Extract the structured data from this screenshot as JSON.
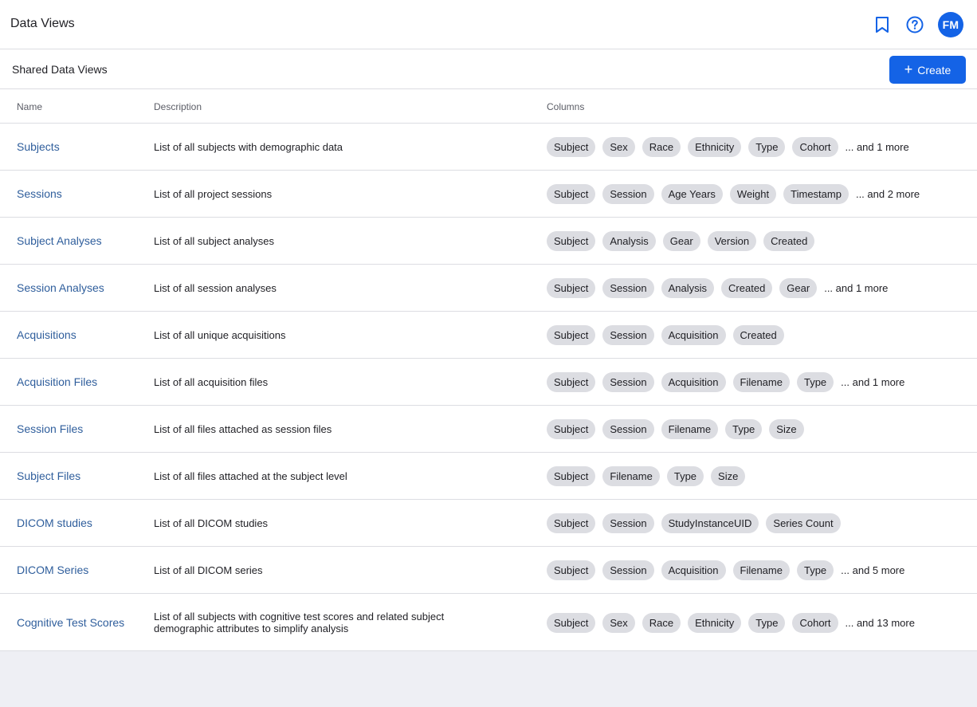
{
  "header": {
    "title": "Data Views",
    "avatar_initials": "FM"
  },
  "panel": {
    "subtitle": "Shared Data Views",
    "create_label": "Create"
  },
  "table": {
    "headers": {
      "name": "Name",
      "description": "Description",
      "columns": "Columns"
    },
    "rows": [
      {
        "name": "Subjects",
        "description": "List of all subjects with demographic data",
        "columns": [
          "Subject",
          "Sex",
          "Race",
          "Ethnicity",
          "Type",
          "Cohort"
        ],
        "more": "... and 1 more"
      },
      {
        "name": "Sessions",
        "description": "List of all project sessions",
        "columns": [
          "Subject",
          "Session",
          "Age Years",
          "Weight",
          "Timestamp"
        ],
        "more": "... and 2 more"
      },
      {
        "name": "Subject Analyses",
        "description": "List of all subject analyses",
        "columns": [
          "Subject",
          "Analysis",
          "Gear",
          "Version",
          "Created"
        ],
        "more": ""
      },
      {
        "name": "Session Analyses",
        "description": "List of all session analyses",
        "columns": [
          "Subject",
          "Session",
          "Analysis",
          "Created",
          "Gear"
        ],
        "more": "... and 1 more"
      },
      {
        "name": "Acquisitions",
        "description": "List of all unique acquisitions",
        "columns": [
          "Subject",
          "Session",
          "Acquisition",
          "Created"
        ],
        "more": ""
      },
      {
        "name": "Acquisition Files",
        "description": "List of all acquisition files",
        "columns": [
          "Subject",
          "Session",
          "Acquisition",
          "Filename",
          "Type"
        ],
        "more": "... and 1 more"
      },
      {
        "name": "Session Files",
        "description": "List of all files attached as session files",
        "columns": [
          "Subject",
          "Session",
          "Filename",
          "Type",
          "Size"
        ],
        "more": ""
      },
      {
        "name": "Subject Files",
        "description": "List of all files attached at the subject level",
        "columns": [
          "Subject",
          "Filename",
          "Type",
          "Size"
        ],
        "more": ""
      },
      {
        "name": "DICOM studies",
        "description": "List of all DICOM studies",
        "columns": [
          "Subject",
          "Session",
          "StudyInstanceUID",
          "Series Count"
        ],
        "more": ""
      },
      {
        "name": "DICOM Series",
        "description": "List of all DICOM series",
        "columns": [
          "Subject",
          "Session",
          "Acquisition",
          "Filename",
          "Type"
        ],
        "more": "... and 5 more"
      },
      {
        "name": "Cognitive Test Scores",
        "description": "List of all subjects with cognitive test scores and related subject demographic attributes to simplify analysis",
        "columns": [
          "Subject",
          "Sex",
          "Race",
          "Ethnicity",
          "Type",
          "Cohort"
        ],
        "more": "... and 13 more"
      }
    ]
  },
  "icons": {
    "bookmark": "bookmark-icon",
    "help": "help-circle-icon",
    "plus": "plus-icon"
  },
  "colors": {
    "accent": "#1463e6",
    "link": "#2f5e9c",
    "chip_bg": "#dcdde2",
    "page_bg": "#eeeff4"
  }
}
